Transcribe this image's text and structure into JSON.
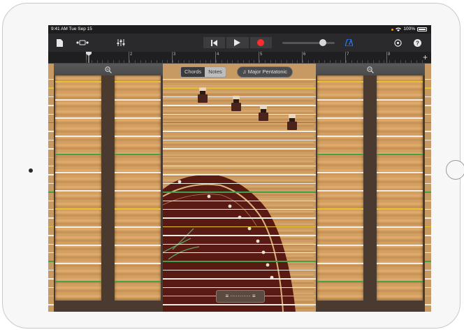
{
  "status": {
    "time": "9:41 AM  Tue Sep 15",
    "battery": "100%"
  },
  "toolbar": {
    "browser_icon": "document-icon",
    "view_icon": "track-view-icon",
    "mixer_icon": "mixer-sliders-icon",
    "rewind_icon": "go-to-beginning-icon",
    "play_icon": "play-icon",
    "record_icon": "record-icon",
    "metronome_icon": "metronome-icon",
    "settings_icon": "settings-icon",
    "help_icon": "help-icon",
    "volume_level": 0.72,
    "record_color": "#ff2d2d",
    "metronome_color": "#2f7bff"
  },
  "ruler": {
    "bars": [
      "3",
      "2",
      "3",
      "4",
      "5",
      "6",
      "7",
      "8"
    ],
    "add_label": "+"
  },
  "controls": {
    "left_zoom_icon": "zoom-out-icon",
    "right_zoom_icon": "zoom-out-icon",
    "mode_chords": "Chords",
    "mode_notes": "Notes",
    "selected_mode": "Notes",
    "scale_label": "Major Pentatonic",
    "scale_icon": "music-note-icon"
  },
  "colors": {
    "string_white": "#f2ede4",
    "string_gold": "#e8c030",
    "string_green": "#3fa24a",
    "guzheng_body": "#5a1a14"
  }
}
